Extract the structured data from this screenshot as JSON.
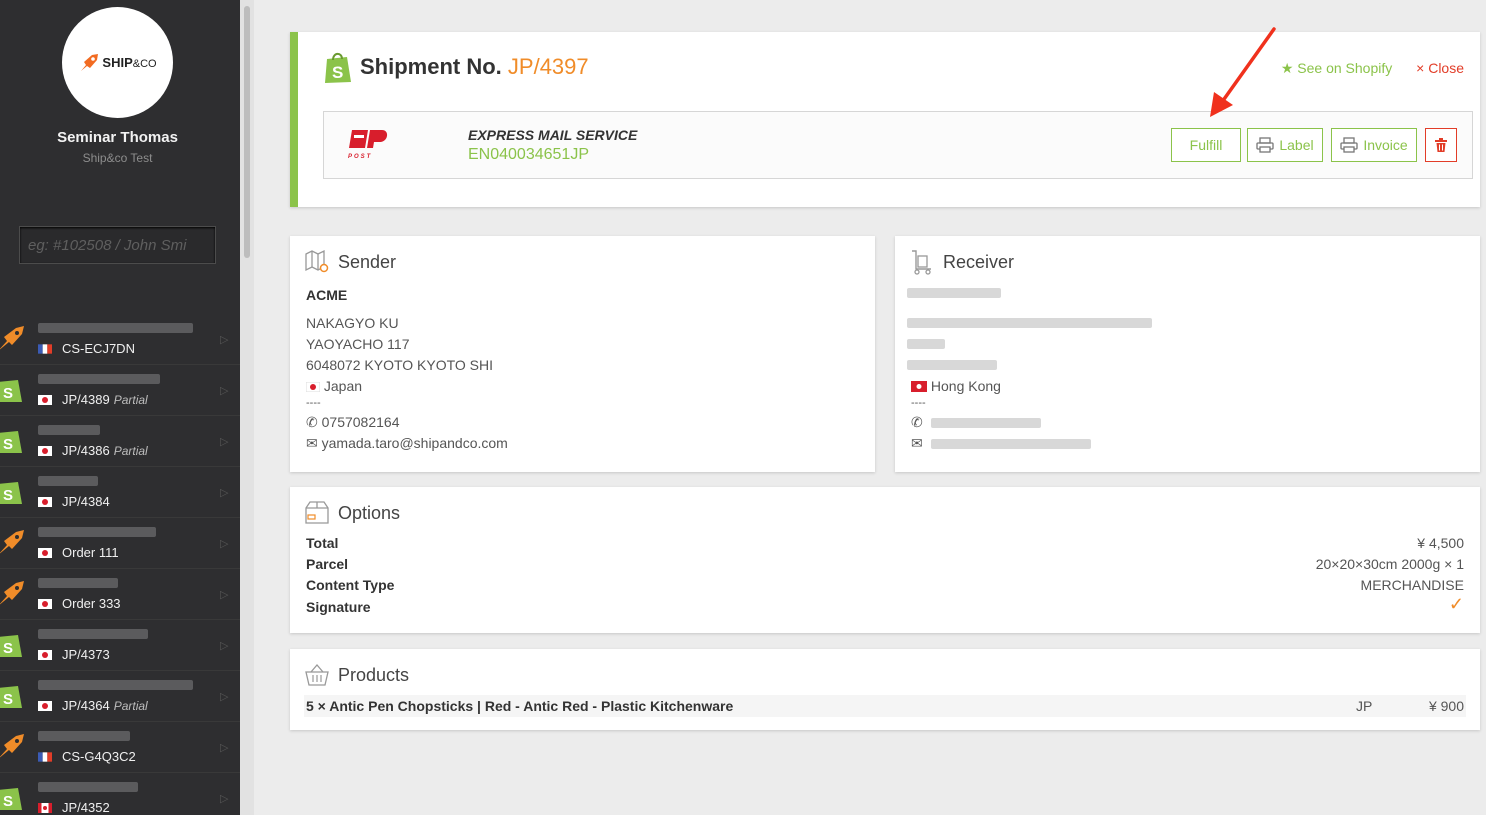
{
  "user": {
    "name": "Seminar Thomas",
    "org": "Ship&co Test"
  },
  "logo": {
    "text_bold": "SHIP",
    "text_light": "&CO"
  },
  "search": {
    "placeholder": "eg: #102508 / John Smi"
  },
  "orders": [
    {
      "source": "shipandco",
      "flag": "fr",
      "code": "CS-ECJ7DN",
      "partial": ""
    },
    {
      "source": "shopify",
      "flag": "jp",
      "code": "JP/4389",
      "partial": "Partial"
    },
    {
      "source": "shopify",
      "flag": "jp",
      "code": "JP/4386",
      "partial": "Partial"
    },
    {
      "source": "shopify",
      "flag": "jp",
      "code": "JP/4384",
      "partial": ""
    },
    {
      "source": "shipandco",
      "flag": "jp",
      "code": "Order 111",
      "partial": ""
    },
    {
      "source": "shipandco",
      "flag": "jp",
      "code": "Order 333",
      "partial": ""
    },
    {
      "source": "shopify",
      "flag": "jp",
      "code": "JP/4373",
      "partial": ""
    },
    {
      "source": "shopify",
      "flag": "jp",
      "code": "JP/4364",
      "partial": "Partial"
    },
    {
      "source": "shipandco",
      "flag": "fr",
      "code": "CS-G4Q3C2",
      "partial": ""
    },
    {
      "source": "shopify",
      "flag": "ca",
      "code": "JP/4352",
      "partial": ""
    }
  ],
  "shipment": {
    "label": "Shipment No.",
    "number": "JP/4397",
    "see_on_shopify": "★ See on Shopify",
    "close": "× Close",
    "service": "EXPRESS MAIL SERVICE",
    "tracking": "EN040034651JP",
    "carrier_logo_text": "POST",
    "fulfill": "Fulfill",
    "label_btn": "Label",
    "invoice_btn": "Invoice"
  },
  "sender": {
    "title": "Sender",
    "company": "ACME",
    "line1": "NAKAGYO KU",
    "line2": "YAOYACHO 117",
    "line3": "6048072 KYOTO KYOTO SHI",
    "country": "Japan",
    "separator": "----",
    "phone": "0757082164",
    "email": "yamada.taro@shipandco.com"
  },
  "receiver": {
    "title": "Receiver",
    "country": "Hong Kong",
    "separator": "----"
  },
  "options": {
    "title": "Options",
    "total_label": "Total",
    "total_value": "¥ 4,500",
    "parcel_label": "Parcel",
    "parcel_value": "20×20×30cm 2000g × 1",
    "content_label": "Content Type",
    "content_value": "MERCHANDISE",
    "signature_label": "Signature",
    "signature_value": "✓"
  },
  "products": {
    "title": "Products",
    "items": [
      {
        "name": "5 × Antic Pen Chopsticks | Red - Antic Red - Plastic Kitchenware",
        "origin": "JP",
        "price": "¥ 900"
      }
    ]
  },
  "colors": {
    "accent": "#8bc34a",
    "orange": "#f08c29",
    "danger": "#e23d28",
    "sidebar": "#2e2e30"
  }
}
